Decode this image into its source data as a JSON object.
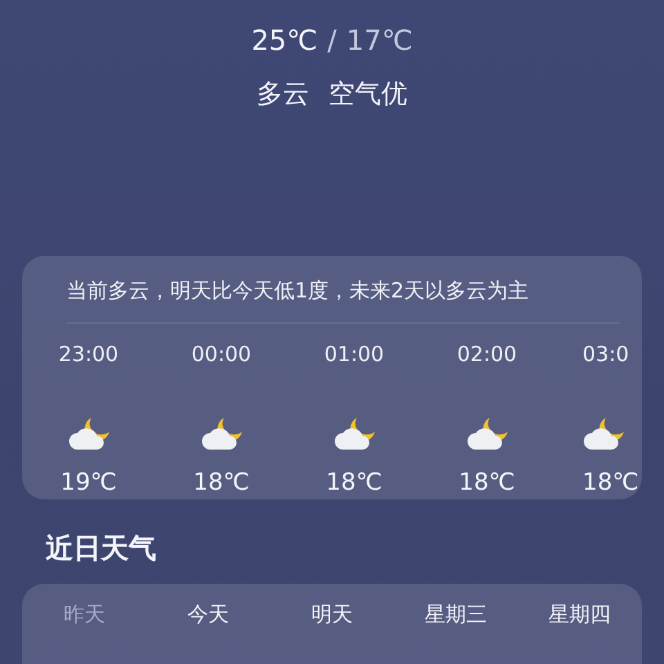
{
  "today": {
    "high": "25℃",
    "separator": "/",
    "low": "17℃",
    "condition": "多云",
    "air": "空气优"
  },
  "hourly": {
    "summary": "当前多云，明天比今天低1度，未来2天以多云为主",
    "items": [
      {
        "time": "23:00",
        "temp": "19℃"
      },
      {
        "time": "00:00",
        "temp": "18℃"
      },
      {
        "time": "01:00",
        "temp": "18℃"
      },
      {
        "time": "02:00",
        "temp": "18℃"
      },
      {
        "time": "03:0",
        "temp": "18℃"
      }
    ]
  },
  "recent": {
    "title": "近日天气",
    "days": [
      {
        "label": "昨天",
        "past": true
      },
      {
        "label": "今天",
        "past": false
      },
      {
        "label": "明天",
        "past": false
      },
      {
        "label": "星期三",
        "past": false
      },
      {
        "label": "星期四",
        "past": false
      }
    ]
  }
}
